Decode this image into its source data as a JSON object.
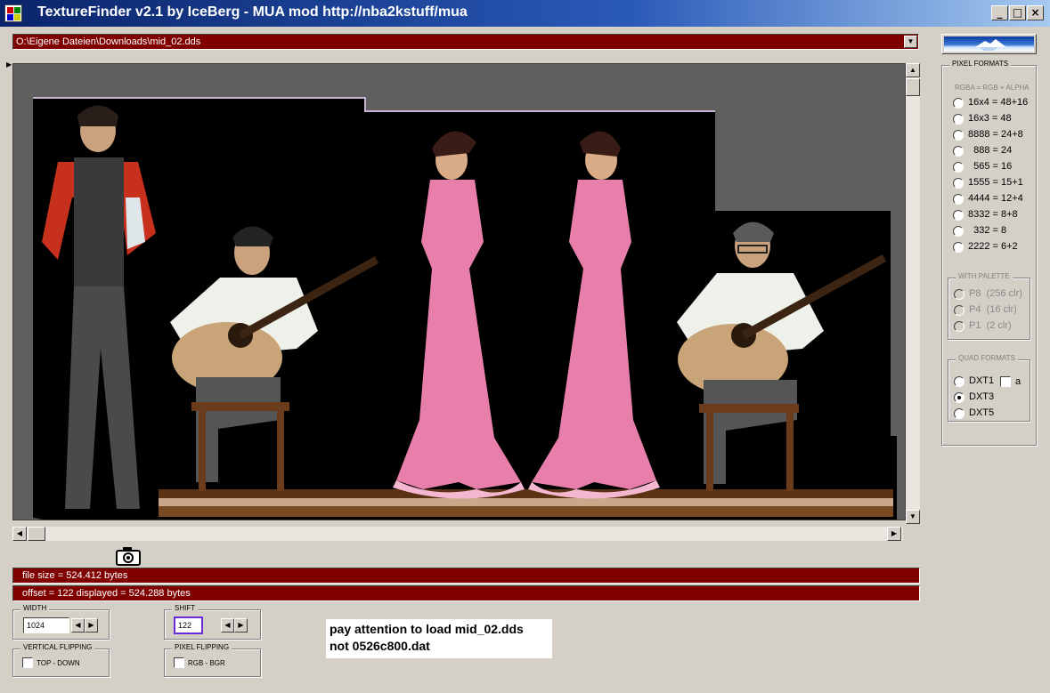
{
  "window": {
    "title": "TextureFinder v2.1 by IceBerg - MUA mod http://nba2kstuff/mua",
    "minimize": "_",
    "maximize": "□",
    "close": "×"
  },
  "path": {
    "value": "O:\\Eigene Dateien\\Downloads\\mid_02.dds"
  },
  "status": {
    "file_size": "file size = 524.412 bytes",
    "offset_line": "offset = 122   displayed = 524.288 bytes"
  },
  "width": {
    "label": "WIDTH",
    "value": "1024"
  },
  "shift": {
    "label": "SHIFT",
    "value": "122"
  },
  "vertical_flipping": {
    "label": "VERTICAL FLIPPING",
    "option": "TOP - DOWN"
  },
  "pixel_flipping": {
    "label": "PIXEL FLIPPING",
    "option": "RGB  -  BGR"
  },
  "note": {
    "line1": "pay attention to load mid_02.dds",
    "line2": "not 0526c800.dat"
  },
  "pixel_formats": {
    "label": "PIXEL FORMATS",
    "sublabel": "RGBA = RGB + ALPHA",
    "options": [
      "16x4 = 48+16",
      "16x3 = 48",
      "8888 = 24+8",
      "  888 = 24",
      "  565 = 16",
      "1555 = 15+1",
      "4444 = 12+4",
      "8332 = 8+8",
      "  332 = 8",
      "2222 = 6+2"
    ]
  },
  "with_palette": {
    "label": "WITH PALETTE",
    "options": [
      "P8  (256 clr)",
      "P4  (16 clr)",
      "P1  (2 clr)"
    ]
  },
  "quad_formats": {
    "label": "QUAD FORMATS",
    "options": [
      "DXT1",
      "DXT3",
      "DXT5"
    ],
    "selected": "DXT3",
    "alpha_label": "a"
  },
  "colors": {
    "status_bar": "#800000",
    "viewport_bg": "#5f5f5f",
    "title_gradient": "#0a246a"
  },
  "preview": {
    "description_icon": "texture-preview"
  }
}
